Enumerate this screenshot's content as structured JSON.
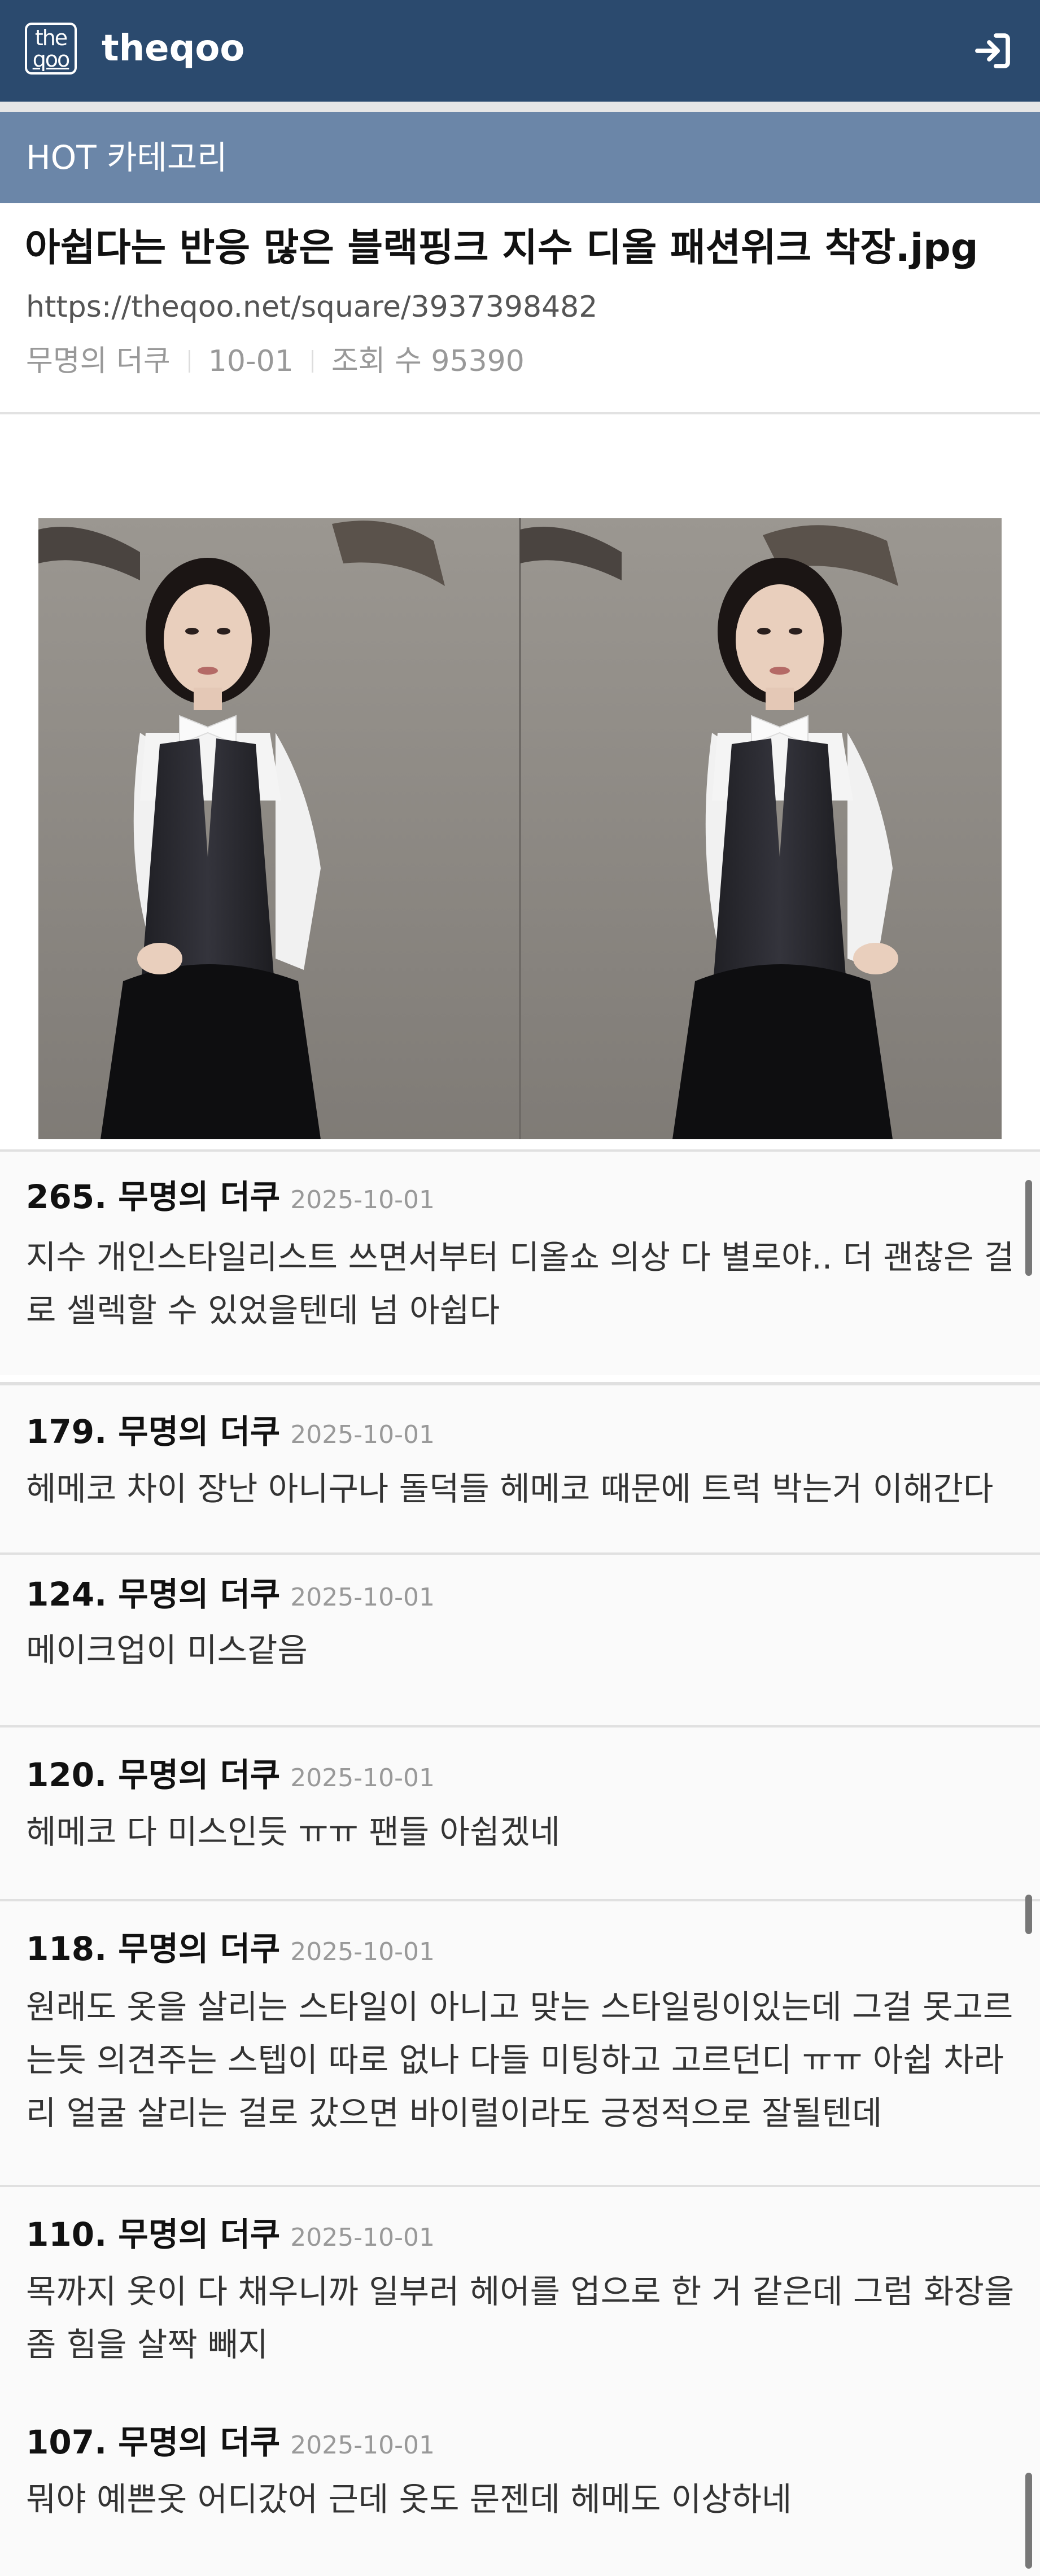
{
  "header": {
    "logo_top": "the",
    "logo_bottom": "qoo",
    "site_name": "theqoo",
    "login_icon": "login-arrow-icon"
  },
  "category": {
    "label": "HOT 카테고리"
  },
  "post": {
    "title": "아쉽다는 반응 많은 블랙핑크 지수 디올 패션위크 착장.jpg",
    "url": "https://theqoo.net/square/3937398482",
    "author": "무명의 더쿠",
    "date": "10-01",
    "views_label": "조회 수 95390"
  },
  "comments": [
    {
      "num": "265. 무명의 더쿠",
      "date": "2025-10-01",
      "text": "지수 개인스타일리스트 쓰면서부터 디올쇼 의상 다 별로야.. 더 괜찮은 걸로 셀렉할 수 있었을텐데 넘 아쉽다"
    },
    {
      "num": "179. 무명의 더쿠",
      "date": "2025-10-01",
      "text": "헤메코 차이 장난 아니구나 돌덕들 헤메코 때문에 트럭 박는거 이해간다"
    },
    {
      "num": "124. 무명의 더쿠",
      "date": "2025-10-01",
      "text": "메이크업이 미스같음"
    },
    {
      "num": "120. 무명의 더쿠",
      "date": "2025-10-01",
      "text": "헤메코 다 미스인듯 ㅠㅠ 팬들 아쉽겠네"
    },
    {
      "num": "118. 무명의 더쿠",
      "date": "2025-10-01",
      "text": "원래도 옷을 살리는 스타일이 아니고 맞는 스타일링이있는데 그걸 못고르는듯 의견주는 스텝이 따로 없나 다들 미팅하고 고르던디 ㅠㅠ 아쉽 차라리 얼굴 살리는 걸로 갔으면 바이럴이라도 긍정적으로 잘될텐데"
    },
    {
      "num": "110. 무명의 더쿠",
      "date": "2025-10-01",
      "text": "목까지 옷이 다 채우니까 일부러 헤어를 업으로 한 거 같은데 그럼 화장을 좀 힘을 살짝 빼지"
    },
    {
      "num": "107. 무명의 더쿠",
      "date": "2025-10-01",
      "text": "뭐야 예쁜옷 어디갔어 근데 옷도 문젠데 헤메도 이상하네"
    }
  ],
  "colors": {
    "header_bg": "#2b4a6e",
    "category_bg": "#6b86a8"
  }
}
